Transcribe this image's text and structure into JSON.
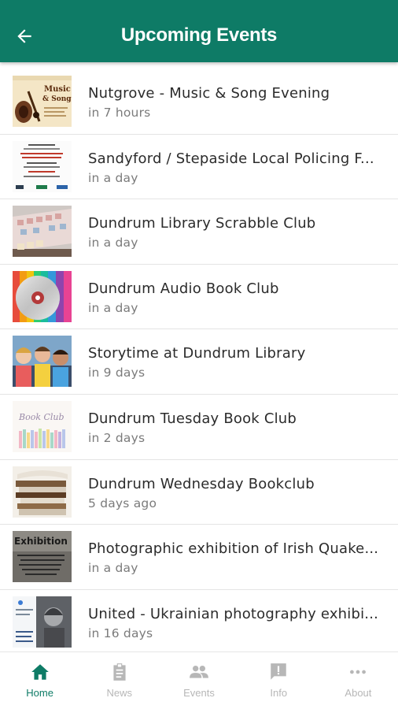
{
  "appbar": {
    "title": "Upcoming Events",
    "back_icon": "arrow-left-icon"
  },
  "events": [
    {
      "title": "Nutgrove - Music & Song Evening",
      "time": "in 7 hours",
      "thumb": "music-song-poster"
    },
    {
      "title": "Sandyford / Stepaside Local Policing F...",
      "time": "in a day",
      "thumb": "policing-flyer"
    },
    {
      "title": "Dundrum Library Scrabble Club",
      "time": "in a day",
      "thumb": "scrabble-board"
    },
    {
      "title": "Dundrum Audio Book Club",
      "time": "in a day",
      "thumb": "cd-disc"
    },
    {
      "title": "Storytime at Dundrum Library",
      "time": "in 9 days",
      "thumb": "children-photo"
    },
    {
      "title": "Dundrum Tuesday Book Club",
      "time": "in 2 days",
      "thumb": "book-club-graphic"
    },
    {
      "title": "Dundrum Wednesday Bookclub",
      "time": "5 days ago",
      "thumb": "book-stack"
    },
    {
      "title": "Photographic exhibition of Irish Quake...",
      "time": "in a day",
      "thumb": "exhibition-poster"
    },
    {
      "title": "United - Ukrainian photography exhibi...",
      "time": "in 16 days",
      "thumb": "ukrainian-exhibition"
    }
  ],
  "thumb_text": {
    "music": "Music",
    "song": "& Song",
    "book_club": "Book Club",
    "exhibition": "Exhibition"
  },
  "tabs": [
    {
      "label": "Home",
      "icon": "home-icon",
      "active": true
    },
    {
      "label": "News",
      "icon": "clipboard-icon",
      "active": false
    },
    {
      "label": "Events",
      "icon": "people-icon",
      "active": false
    },
    {
      "label": "Info",
      "icon": "info-message-icon",
      "active": false
    },
    {
      "label": "About",
      "icon": "more-dots-icon",
      "active": false
    }
  ],
  "colors": {
    "primary": "#0e7b66",
    "inactive": "#b7b7b7"
  }
}
